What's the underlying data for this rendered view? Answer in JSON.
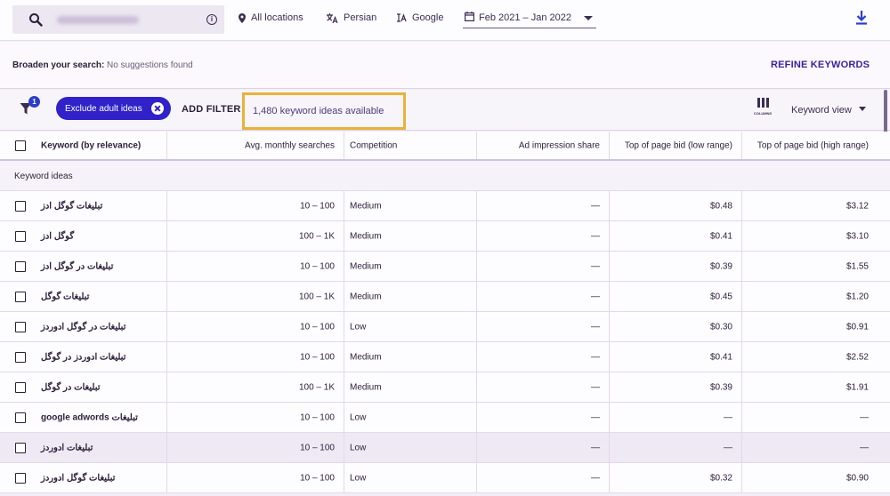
{
  "topbar": {
    "locations": "All locations",
    "language": "Persian",
    "network": "Google",
    "date_range": "Feb 2021 – Jan 2022"
  },
  "broaden": {
    "label": "Broaden your search:",
    "value": "No suggestions found",
    "refine": "REFINE KEYWORDS"
  },
  "filterbar": {
    "filter_count": "1",
    "chip_label": "Exclude adult ideas",
    "add_filter": "ADD FILTER",
    "ideas_available": "1,480 keyword ideas available",
    "columns_label": "COLUMNS",
    "view_label": "Keyword view"
  },
  "table": {
    "headers": [
      "Keyword (by relevance)",
      "Avg. monthly searches",
      "Competition",
      "Ad impression share",
      "Top of page bid (low range)",
      "Top of page bid (high range)"
    ],
    "section_label": "Keyword ideas",
    "rows": [
      {
        "keyword": "تبلیغات گوگل ادز",
        "searches": "10 – 100",
        "competition": "Medium",
        "share": "—",
        "low": "$0.48",
        "high": "$3.12"
      },
      {
        "keyword": "گوگل ادز",
        "searches": "100 – 1K",
        "competition": "Medium",
        "share": "—",
        "low": "$0.41",
        "high": "$3.10"
      },
      {
        "keyword": "تبلیغات در گوگل ادز",
        "searches": "10 – 100",
        "competition": "Medium",
        "share": "—",
        "low": "$0.39",
        "high": "$1.55"
      },
      {
        "keyword": "تبلیغات گوگل",
        "searches": "100 – 1K",
        "competition": "Medium",
        "share": "—",
        "low": "$0.45",
        "high": "$1.20"
      },
      {
        "keyword": "تبلیغات در گوگل ادوردز",
        "searches": "10 – 100",
        "competition": "Low",
        "share": "—",
        "low": "$0.30",
        "high": "$0.91"
      },
      {
        "keyword": "تبلیغات ادوردز در گوگل",
        "searches": "10 – 100",
        "competition": "Medium",
        "share": "—",
        "low": "$0.41",
        "high": "$2.52"
      },
      {
        "keyword": "تبلیغات در گوگل",
        "searches": "100 – 1K",
        "competition": "Medium",
        "share": "—",
        "low": "$0.39",
        "high": "$1.91"
      },
      {
        "keyword": "تبلیغات google adwords",
        "searches": "10 – 100",
        "competition": "Low",
        "share": "—",
        "low": "—",
        "high": "—"
      },
      {
        "keyword": "تبلیغات ادوردز",
        "searches": "10 – 100",
        "competition": "Low",
        "share": "—",
        "low": "—",
        "high": "—"
      },
      {
        "keyword": "تبلیغات گوگل ادوردز",
        "searches": "10 – 100",
        "competition": "Low",
        "share": "—",
        "low": "$0.32",
        "high": "$0.90"
      }
    ]
  }
}
